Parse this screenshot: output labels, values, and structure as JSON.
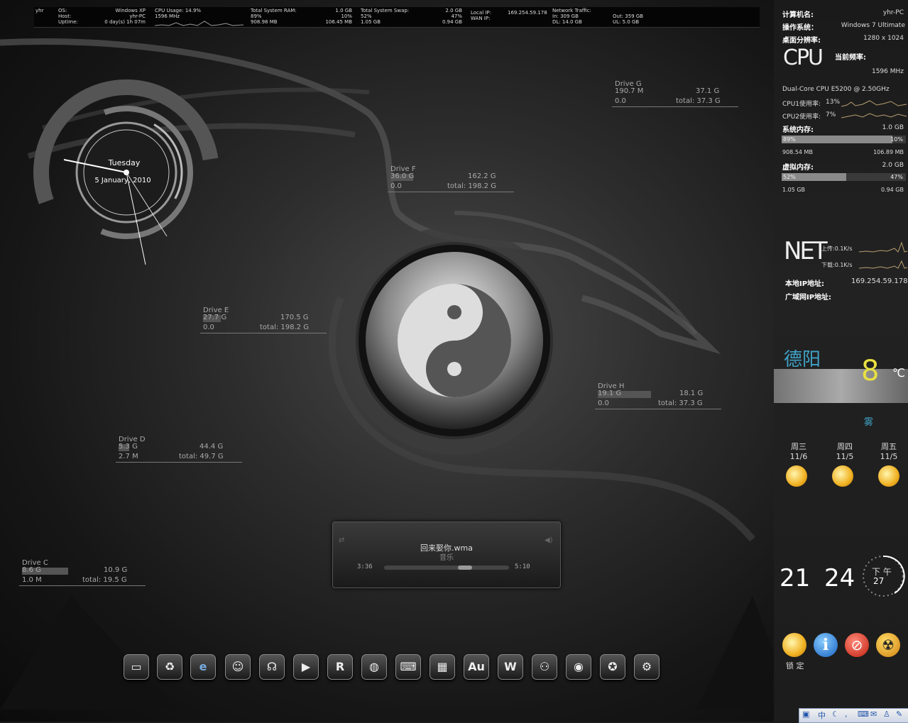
{
  "topbar": {
    "logo": "yhr",
    "os_label": "OS:",
    "os_value": "Windows XP",
    "host_label": "Host:",
    "host_value": "yhr-PC",
    "uptime_label": "Uptime:",
    "uptime_value": "0 day(s) 1h 07m",
    "cpu_usage": "CPU Usage: 14.9%",
    "cpu_mhz": "1596 MHz",
    "ram_label": "Total System RAM:",
    "ram_total": "1.0 GB",
    "ram_pct": "89%",
    "ram_free_pct": "10%",
    "ram_used": "908.98 MB",
    "ram_free": "106.45 MB",
    "swap_label": "Total System Swap:",
    "swap_total": "2.0 GB",
    "swap_pct": "52%",
    "swap_free_pct": "47%",
    "swap_used": "1.05 GB",
    "swap_free": "0.94 GB",
    "local_ip_label": "Local IP:",
    "local_ip": "169.254.59.178",
    "wan_ip_label": "WAN IP:",
    "net_label": "Network Traffic:",
    "net_in": "In: 309 GB",
    "net_dl": "DL: 14.0 GB",
    "net_out": "Out: 359 GB",
    "net_ul": "UL: 5.0 GB"
  },
  "clock": {
    "day": "Tuesday",
    "date": "5 January, 2010"
  },
  "drives": [
    {
      "name": "Drive G",
      "used": "190.7 M",
      "free": "37.1 G",
      "rate": "0.0",
      "total": "total: 37.3 G"
    },
    {
      "name": "Drive F",
      "used": "36.0 G",
      "free": "162.2 G",
      "rate": "0.0",
      "total": "total: 198.2 G"
    },
    {
      "name": "Drive E",
      "used": "27.7 G",
      "free": "170.5 G",
      "rate": "0.0",
      "total": "total: 198.2 G"
    },
    {
      "name": "Drive H",
      "used": "19.1 G",
      "free": "18.1 G",
      "rate": "0.0",
      "total": "total: 37.3 G"
    },
    {
      "name": "Drive D",
      "used": "5.3 G",
      "free": "44.4 G",
      "rate": "2.7 M",
      "total": "total: 49.7 G"
    },
    {
      "name": "Drive C",
      "used": "8.6 G",
      "free": "10.9 G",
      "rate": "1.0 M",
      "total": "total: 19.5 G"
    }
  ],
  "player": {
    "track": "回来娶你.wma",
    "artist": "音乐",
    "elapsed": "3:36",
    "duration": "5:10",
    "progress": 0.7
  },
  "dock": {
    "icons": [
      "computer-icon",
      "recycle-bin-icon",
      "internet-explorer-icon",
      "messenger-icon",
      "headset-icon",
      "media-icon",
      "rar-icon",
      "globe-icon",
      "keyboard-icon",
      "package-icon",
      "audition-icon",
      "word-icon",
      "network-icon",
      "alien-icon",
      "browser-icon",
      "settings-icon"
    ],
    "au_label": "Au",
    "w_label": "W",
    "r_label": "R"
  },
  "sysinfo": {
    "computer_name_label": "计算机名:",
    "computer_name": "yhr-PC",
    "os_label": "操作系统：",
    "os": "Windows 7 Ultimate",
    "resolution_label": "桌面分辨率:",
    "resolution": "1280 x 1024",
    "cpu_logo": "CPU",
    "freq_label": "当前频率:",
    "freq": "1596 MHz",
    "cpu_model": "Dual-Core CPU E5200 @ 2.50GHz",
    "cpu1_label": "CPU1使用率:",
    "cpu1": "13%",
    "cpu2_label": "CPU2使用率:",
    "cpu2": "7%",
    "mem_label": "系统内存:",
    "mem_total": "1.0 GB",
    "mem_used_pct": "89%",
    "mem_free_pct": "10%",
    "mem_pct_value": 0.89,
    "mem_used": "908.54 MB",
    "mem_free": "106.89 MB",
    "vmem_label": "虚拟内存:",
    "vmem_total": "2.0 GB",
    "vmem_used_pct": "52%",
    "vmem_free_pct": "47%",
    "vmem_pct_value": 0.52,
    "vmem_used": "1.05 GB",
    "vmem_free": "0.94 GB"
  },
  "net": {
    "logo": "NET",
    "upload": "上传:0.1K/s",
    "download": "下载:0.1K/s",
    "local_ip_label": "本地IP地址:",
    "local_ip": "169.254.59.178",
    "wan_ip_label": "广域网IP地址:"
  },
  "weather": {
    "city": "德阳",
    "temp": "8",
    "unit": "℃",
    "condition": "雾",
    "days": [
      {
        "day": "周三",
        "range": "11/6"
      },
      {
        "day": "周四",
        "range": "11/5"
      },
      {
        "day": "周五",
        "range": "11/5"
      }
    ]
  },
  "time": {
    "hour": "21",
    "minute": "24",
    "ampm": "下 午",
    "second": "27"
  },
  "launchers": {
    "lock_label": "锁 定"
  },
  "tray": {
    "ime": "中",
    "items": [
      "ime-logo-icon",
      "moon-icon",
      "comma-icon",
      "keyboard-icon",
      "chat-icon",
      "person-icon",
      "wrench-icon"
    ]
  }
}
